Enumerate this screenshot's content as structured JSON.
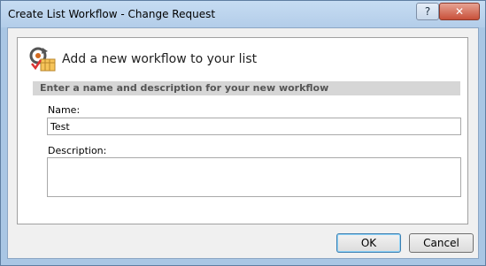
{
  "window": {
    "title": "Create List Workflow - Change Request",
    "help_label": "?",
    "close_label": "✕"
  },
  "header": {
    "icon": "workflow-icon",
    "text": "Add a new workflow to your list"
  },
  "section": {
    "title": "Enter a name and description for your new workflow"
  },
  "form": {
    "name_label": "Name:",
    "name_value": "Test",
    "description_label": "Description:",
    "description_value": ""
  },
  "buttons": {
    "ok_label": "OK",
    "cancel_label": "Cancel"
  }
}
